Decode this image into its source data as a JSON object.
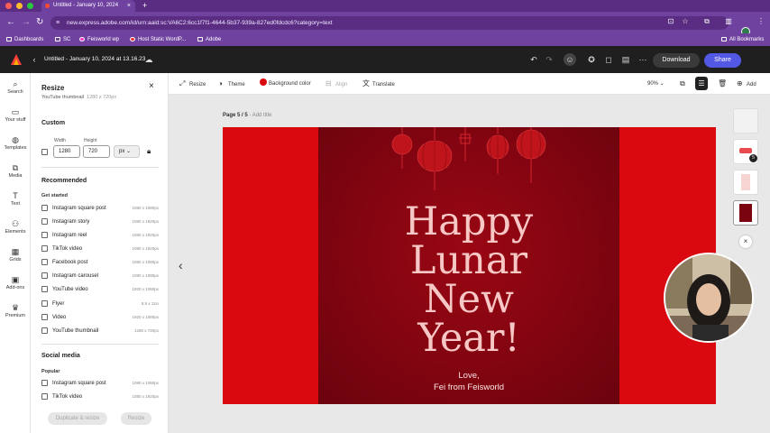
{
  "browser": {
    "tab_title": "Untitled - January 10, 2024",
    "url": "new.express.adobe.com/id/urn:aaid:sc:VA6C2:6cc1f7f1-4644-5b37-939a-827ed0fdcdc6?category=text",
    "bookmarks": [
      "Dashboards",
      "SC",
      "Feisworld wp",
      "Host Static WordP...",
      "Adobe"
    ],
    "all_bookmarks": "All Bookmarks"
  },
  "app": {
    "doc_title": "Untitled - January 10, 2024 at 13.16.23",
    "download": "Download",
    "share": "Share"
  },
  "rail": [
    "Search",
    "Your stuff",
    "Templates",
    "Media",
    "Text",
    "Elements",
    "Grids",
    "Add-ons",
    "Premium"
  ],
  "panel": {
    "title": "Resize",
    "subtitle": "YouTube thumbnail",
    "subtitle_dims": "1280 x 720px",
    "custom": "Custom",
    "width_label": "Width",
    "height_label": "Height",
    "width": "1280",
    "height": "720",
    "unit": "px",
    "recommended": "Recommended",
    "get_started": "Get started",
    "options": [
      {
        "name": "Instagram square post",
        "dims": "1080 x 1080px"
      },
      {
        "name": "Instagram story",
        "dims": "1080 x 1920px"
      },
      {
        "name": "Instagram reel",
        "dims": "1080 x 1920px"
      },
      {
        "name": "TikTok video",
        "dims": "1080 x 1920px"
      },
      {
        "name": "Facebook post",
        "dims": "1080 x 1080px"
      },
      {
        "name": "Instagram carousel",
        "dims": "1080 x 1080px"
      },
      {
        "name": "YouTube video",
        "dims": "1920 x 1080px"
      },
      {
        "name": "Flyer",
        "dims": "8.5 x 11in"
      },
      {
        "name": "Video",
        "dims": "1920 x 1080px"
      },
      {
        "name": "YouTube thumbnail",
        "dims": "1280 x 720px"
      }
    ],
    "social_media": "Social media",
    "popular": "Popular",
    "social_options": [
      {
        "name": "Instagram square post",
        "dims": "1080 x 1080px"
      },
      {
        "name": "TikTok video",
        "dims": "1080 x 1920px"
      }
    ],
    "duplicate_resize": "Duplicate & resize",
    "resize": "Resize"
  },
  "toolbar": {
    "resize": "Resize",
    "theme": "Theme",
    "background_color": "Background color",
    "bg_swatch": "#d9090f",
    "align": "Align",
    "translate": "Translate",
    "zoom": "90%",
    "add": "Add"
  },
  "canvas": {
    "page_label": "Page 5 / 5",
    "add_title": "Add title",
    "greeting_lines": [
      "Happy",
      "Lunar",
      "New",
      "Year!"
    ],
    "love_lines": [
      "Love,",
      "Fei from Feisworld"
    ],
    "page_badge": "5"
  },
  "colors": {
    "accent": "#5258e4",
    "artboard": "#d9090f",
    "artboard_inner": "#7a0410",
    "text_pink": "#f6c7c4"
  }
}
